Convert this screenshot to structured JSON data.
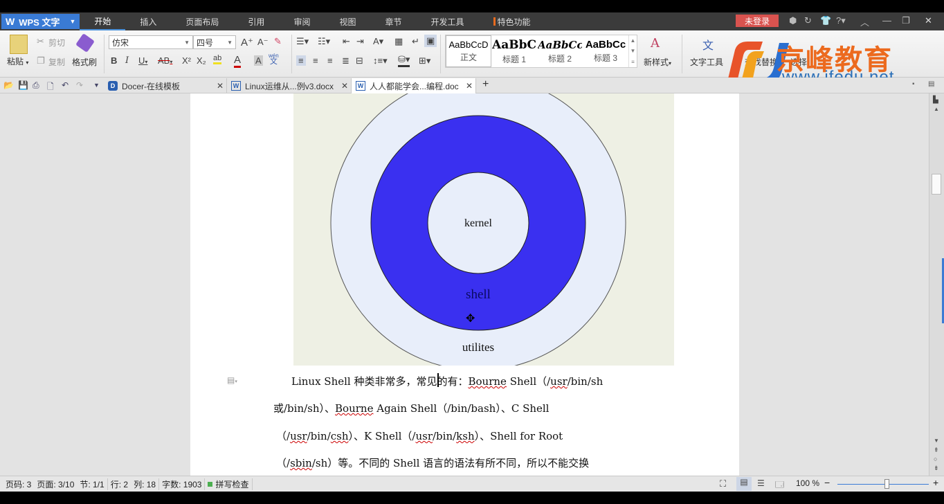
{
  "app": {
    "name": "WPS 文字",
    "logo_icon": "wps-w-icon"
  },
  "menu": {
    "items": [
      "开始",
      "插入",
      "页面布局",
      "引用",
      "审阅",
      "视图",
      "章节",
      "开发工具",
      "特色功能"
    ],
    "active": "开始",
    "login_button": "未登录",
    "help": "?"
  },
  "ribbon": {
    "paste": "粘贴",
    "cut": "剪切",
    "copy": "复制",
    "format_painter": "格式刷",
    "font_name": "仿宋",
    "font_size": "四号",
    "phonetic_top": "wén",
    "phonetic_bottom": "文",
    "styles": [
      {
        "sample": "AaBbCcD",
        "label": "正文"
      },
      {
        "sample": "AaBbC",
        "label": "标题 1"
      },
      {
        "sample": "AaBbCc",
        "label": "标题 2"
      },
      {
        "sample": "AaBbCc",
        "label": "标题 3"
      }
    ],
    "new_style": "新样式",
    "text_tools": "文字工具",
    "find_replace": "查找替换",
    "select": "选择"
  },
  "watermark": {
    "brand": "京峰教育",
    "url": "www.jfedu.net"
  },
  "tabs": [
    {
      "title": "Docer-在线模板",
      "icon": "docer-icon",
      "active": false
    },
    {
      "title": "Linux运维从...例v3.docx",
      "icon": "word-doc-icon",
      "active": false
    },
    {
      "title": "人人都能学会...编程.doc",
      "icon": "word-doc-icon",
      "active": true
    }
  ],
  "document": {
    "figure": {
      "labels": {
        "inner": "kernel",
        "middle": "shell",
        "outer": "utilites"
      },
      "colors": {
        "shell_ring": "#3a30f0",
        "light_fill": "#e8eefa",
        "background": "#eef0e4"
      }
    },
    "paragraph_lines": [
      [
        {
          "t": "Linux Shell 种类非常多，"
        },
        {
          "t": "常见的有："
        },
        {
          "t": "Bourne",
          "sq": true
        },
        {
          "t": " Shell（/"
        },
        {
          "t": "usr",
          "sq": true
        },
        {
          "t": "/bin/sh"
        }
      ],
      [
        {
          "t": "或/bin/sh）、"
        },
        {
          "t": "Bourne",
          "sq": true
        },
        {
          "t": " Again Shell（/bin/bash）、C Shell"
        }
      ],
      [
        {
          "t": "（/"
        },
        {
          "t": "usr",
          "sq": true
        },
        {
          "t": "/bin/"
        },
        {
          "t": "csh",
          "sq": true
        },
        {
          "t": "）、K Shell（/"
        },
        {
          "t": "usr",
          "sq": true
        },
        {
          "t": "/bin/"
        },
        {
          "t": "ksh",
          "sq": true
        },
        {
          "t": "）、Shell for Root"
        }
      ],
      [
        {
          "t": "（/"
        },
        {
          "t": "sbin",
          "sq": true
        },
        {
          "t": "/sh）等。不同的 Shell 语言的语法有所不同，所以不能交换"
        }
      ]
    ]
  },
  "status": {
    "page_code": "页码: 3",
    "page": "页面: 3/10",
    "section": "节: 1/1",
    "row": "行: 2",
    "col": "列: 18",
    "word_count": "字数: 1903",
    "spell_check": "拼写检查",
    "zoom": "100 %",
    "zoom_fraction": 0.5
  }
}
